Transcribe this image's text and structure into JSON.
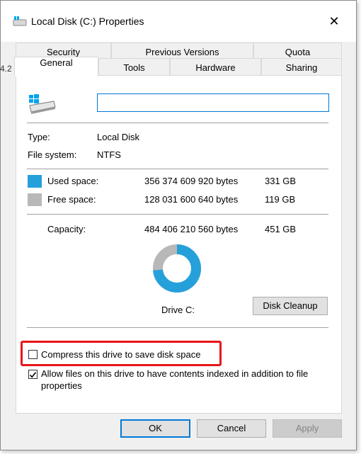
{
  "window": {
    "title": "Local Disk (C:) Properties",
    "close_glyph": "✕"
  },
  "background": {
    "sliver_text": "4.2"
  },
  "tabs": {
    "row1": [
      "Security",
      "Previous Versions",
      "Quota"
    ],
    "row2": [
      "General",
      "Tools",
      "Hardware",
      "Sharing"
    ],
    "active": "General"
  },
  "general": {
    "drive_icon": "drive-icon",
    "name_value": "",
    "type_label": "Type:",
    "type_value": "Local Disk",
    "fs_label": "File system:",
    "fs_value": "NTFS",
    "used": {
      "label": "Used space:",
      "bytes": "356 374 609 920 bytes",
      "size": "331 GB",
      "color": "#26a0da"
    },
    "free": {
      "label": "Free space:",
      "bytes": "128 031 600 640 bytes",
      "size": "119 GB",
      "color": "#b8b8b8"
    },
    "capacity": {
      "label": "Capacity:",
      "bytes": "484 406 210 560 bytes",
      "size": "451 GB"
    },
    "used_fraction": 0.7357,
    "drive_label": "Drive C:",
    "cleanup_button": "Disk Cleanup"
  },
  "options": {
    "compress_label": "Compress this drive to save disk space",
    "compress_checked": false,
    "index_label_line1": "Allow files on this drive to have contents indexed in addition to file",
    "index_label_line2": "properties",
    "index_checked": true
  },
  "buttons": {
    "ok": "OK",
    "cancel": "Cancel",
    "apply": "Apply"
  },
  "colors": {
    "highlight": "#e8151a",
    "accent": "#0078d7"
  }
}
